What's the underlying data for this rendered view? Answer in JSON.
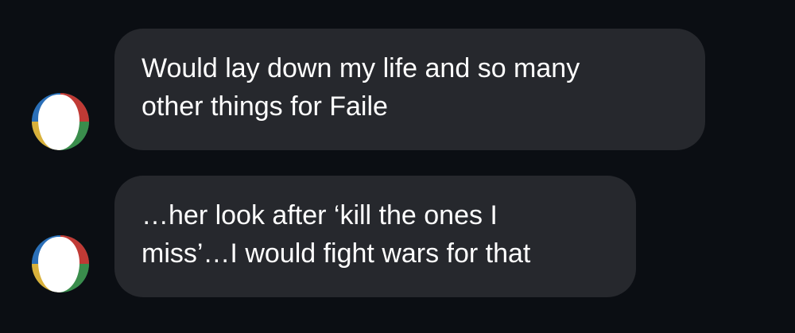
{
  "messages": [
    {
      "lines": [
        "Would lay down my life and so many",
        "other things for Faile"
      ]
    },
    {
      "lines": [
        "…her look after ‘kill the ones I",
        "miss’…I would fight wars for that"
      ]
    }
  ]
}
